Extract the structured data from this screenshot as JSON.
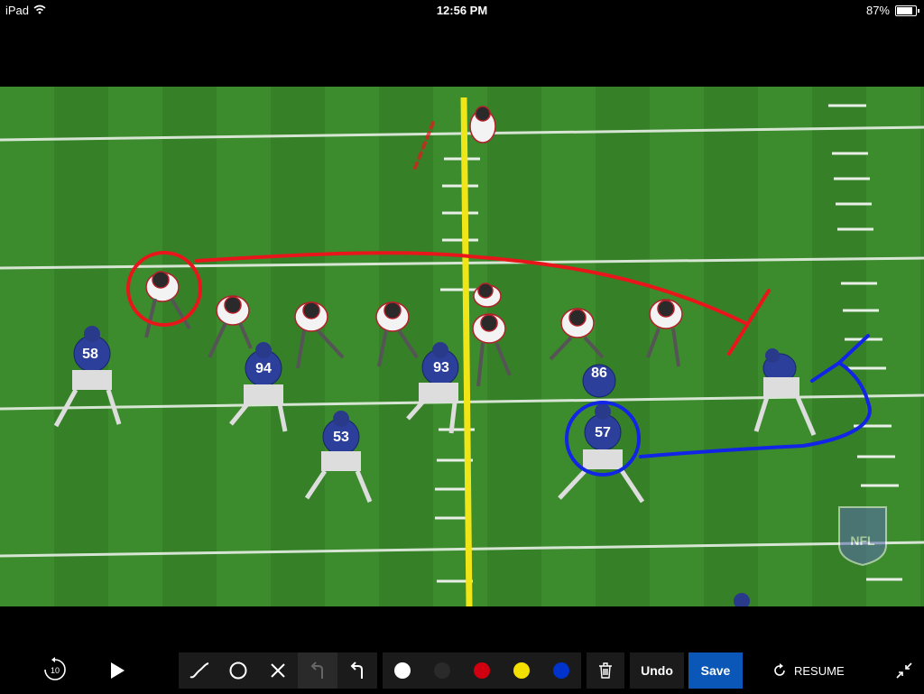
{
  "status_bar": {
    "device": "iPad",
    "time": "12:56 PM",
    "battery": "87%",
    "battery_level": 0.87
  },
  "video": {
    "scoreboard_logo": "NFL",
    "offense_jerseys": [],
    "defense_jerseys": [
      "58",
      "94",
      "93",
      "53",
      "57",
      "86"
    ],
    "drawing": {
      "colors": {
        "red": "#e8161b",
        "blue": "#1224e6"
      }
    }
  },
  "toolbar": {
    "rewind_label": "10",
    "tools": [
      {
        "name": "freehand-tool",
        "icon": "squiggle-icon"
      },
      {
        "name": "circle-tool",
        "icon": "circle-icon"
      },
      {
        "name": "x-tool",
        "icon": "x-icon"
      },
      {
        "name": "arrow-tool",
        "icon": "return-arrow-icon"
      },
      {
        "name": "undo-arrow-tool",
        "icon": "undo-arrow-icon"
      }
    ],
    "colors": [
      {
        "name": "white",
        "hex": "#ffffff"
      },
      {
        "name": "black",
        "hex": "#2a2a2a"
      },
      {
        "name": "red",
        "hex": "#d00010"
      },
      {
        "name": "yellow",
        "hex": "#f4e000"
      },
      {
        "name": "blue",
        "hex": "#0033cc"
      }
    ],
    "undo_label": "Undo",
    "save_label": "Save",
    "resume_label": "RESUME",
    "save_color": "#0a57b8"
  }
}
